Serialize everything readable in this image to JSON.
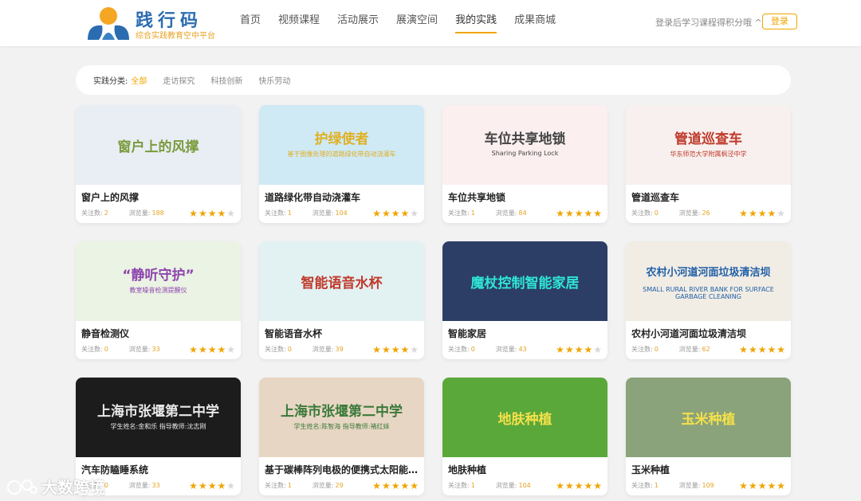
{
  "brand": {
    "title": "践行码",
    "subtitle": "综合实践教育空中平台"
  },
  "nav": [
    {
      "label": "首页",
      "active": false
    },
    {
      "label": "视频课程",
      "active": false
    },
    {
      "label": "活动展示",
      "active": false
    },
    {
      "label": "展演空间",
      "active": false
    },
    {
      "label": "我的实践",
      "active": true
    },
    {
      "label": "成果商城",
      "active": false
    }
  ],
  "login": {
    "tip": "登录后学习课程得积分哦 ^_^",
    "button": "登录"
  },
  "filter": {
    "label": "实践分类:",
    "options": [
      {
        "label": "全部",
        "active": true
      },
      {
        "label": "走访探究",
        "active": false
      },
      {
        "label": "科技创新",
        "active": false
      },
      {
        "label": "快乐劳动",
        "active": false
      }
    ]
  },
  "meta_labels": {
    "follow": "关注数:",
    "views": "浏览量:"
  },
  "cards": [
    {
      "title": "窗户上的风撑",
      "follow": "2",
      "views": "188",
      "rating": 4,
      "thumb_text": "窗户上的风撑",
      "thumb_bg": "#e9eef5",
      "thumb_color": "#7a9a3a"
    },
    {
      "title": "道路绿化带自动浇灌车",
      "follow": "1",
      "views": "104",
      "rating": 4,
      "thumb_text": "护绿使者",
      "thumb_sub": "基于图像处理的道路绿化带自动浇灌车",
      "thumb_bg": "#cfe9f5",
      "thumb_color": "#e0b020"
    },
    {
      "title": "车位共享地锁",
      "follow": "1",
      "views": "84",
      "rating": 5,
      "thumb_text": "车位共享地锁",
      "thumb_sub": "Sharing Parking Lock",
      "thumb_bg": "#fbeff0",
      "thumb_color": "#444"
    },
    {
      "title": "管道巡查车",
      "follow": "0",
      "views": "26",
      "rating": 4,
      "thumb_text": "管道巡查车",
      "thumb_sub": "华东师范大学附属枫泾中学",
      "thumb_bg": "#f7f0ee",
      "thumb_color": "#c0392b"
    },
    {
      "title": "静音检测仪",
      "follow": "0",
      "views": "33",
      "rating": 4,
      "thumb_text": "“静听守护”",
      "thumb_sub": "教室噪音检测提醒仪",
      "thumb_bg": "#eaf3e4",
      "thumb_color": "#8e44ad"
    },
    {
      "title": "智能语音水杯",
      "follow": "0",
      "views": "39",
      "rating": 4,
      "thumb_text": "智能语音水杯",
      "thumb_bg": "#e2f1f2",
      "thumb_color": "#c0392b"
    },
    {
      "title": "智能家居",
      "follow": "0",
      "views": "43",
      "rating": 4,
      "thumb_text": "魔杖控制智能家居",
      "thumb_bg": "#2c3e66",
      "thumb_color": "#2ee6d6"
    },
    {
      "title": "农村小河道河面垃圾清洁坝",
      "follow": "0",
      "views": "62",
      "rating": 5,
      "thumb_text": "农村小河道河面垃圾清洁坝",
      "thumb_sub": "SMALL RURAL RIVER BANK FOR SURFACE GARBAGE CLEANING",
      "thumb_bg": "#f1ece4",
      "thumb_color": "#1f5fa8"
    },
    {
      "title": "汽车防瞌睡系统",
      "follow": "0",
      "views": "33",
      "rating": 4,
      "thumb_text": "上海市张堰第二中学",
      "thumb_sub": "学生姓名:金和乐 指导教师:沈志刚",
      "thumb_bg": "#1c1c1c",
      "thumb_color": "#e8e8e8"
    },
    {
      "title": "基于碳棒阵列电极的便携式太阳能...",
      "follow": "1",
      "views": "29",
      "rating": 5,
      "thumb_text": "上海市张堰第二中学",
      "thumb_sub": "学生姓名:陈智海 指导教师:褚红妹",
      "thumb_bg": "#e8d6c4",
      "thumb_color": "#3a7a3a"
    },
    {
      "title": "地肤种植",
      "follow": "1",
      "views": "104",
      "rating": 5,
      "thumb_text": "地肤种植",
      "thumb_bg": "#5aa83a",
      "thumb_color": "#f5e04a"
    },
    {
      "title": "玉米种植",
      "follow": "1",
      "views": "109",
      "rating": 5,
      "thumb_text": "玉米种植",
      "thumb_bg": "#8aa37a",
      "thumb_color": "#f5e04a"
    }
  ],
  "watermark": "大数跨境"
}
